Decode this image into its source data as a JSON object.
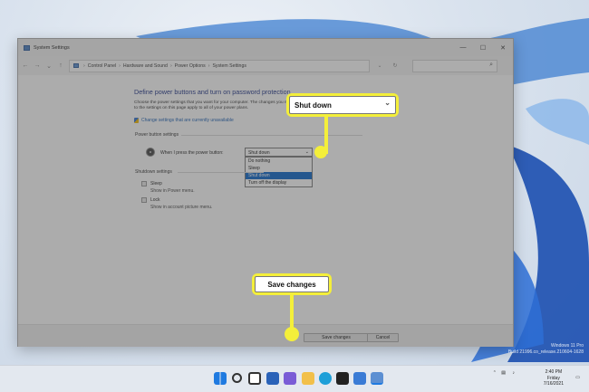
{
  "window": {
    "title": "System Settings",
    "controls": {
      "minimize": "—",
      "maximize": "☐",
      "close": "✕"
    }
  },
  "address": {
    "back": "←",
    "forward": "→",
    "dropdown": "⌄",
    "up": "↑",
    "crumbs": [
      "Control Panel",
      "Hardware and Sound",
      "Power Options",
      "System Settings"
    ],
    "crumb_sep": "›",
    "refresh": "↻",
    "search_placeholder": "",
    "search_icon": "⌕"
  },
  "content": {
    "heading": "Define power buttons and turn on password protection",
    "intro": "Choose the power settings that you want for your computer. The changes you make to the settings on this page apply to all of your power plans.",
    "change_link": "Change settings that are currently unavailable",
    "power_button_section": "Power button settings",
    "power_button_label": "When I press the power button:",
    "power_button_value": "Shut down",
    "power_button_options": [
      "Do nothing",
      "Sleep",
      "Shut down",
      "Turn off the display"
    ],
    "shutdown_section": "Shutdown settings",
    "sleep_label": "Sleep",
    "sleep_desc": "Show in Power menu.",
    "lock_label": "Lock",
    "lock_desc": "Show in account picture menu."
  },
  "footer": {
    "save": "Save changes",
    "cancel": "Cancel"
  },
  "callouts": {
    "dropdown": "Shut down",
    "dropdown_arrow": "⌄",
    "save": "Save changes"
  },
  "watermark": {
    "line1": "Windows 11 Pro",
    "line2": "Build 21996.co_release.210604-1628"
  },
  "taskbar": {
    "time": "2:40 PM",
    "day": "Friday",
    "date": "7/16/2021"
  },
  "colors": {
    "accent": "#1e3287",
    "highlight": "#0a64c8",
    "callout": "#f4ef3a"
  }
}
